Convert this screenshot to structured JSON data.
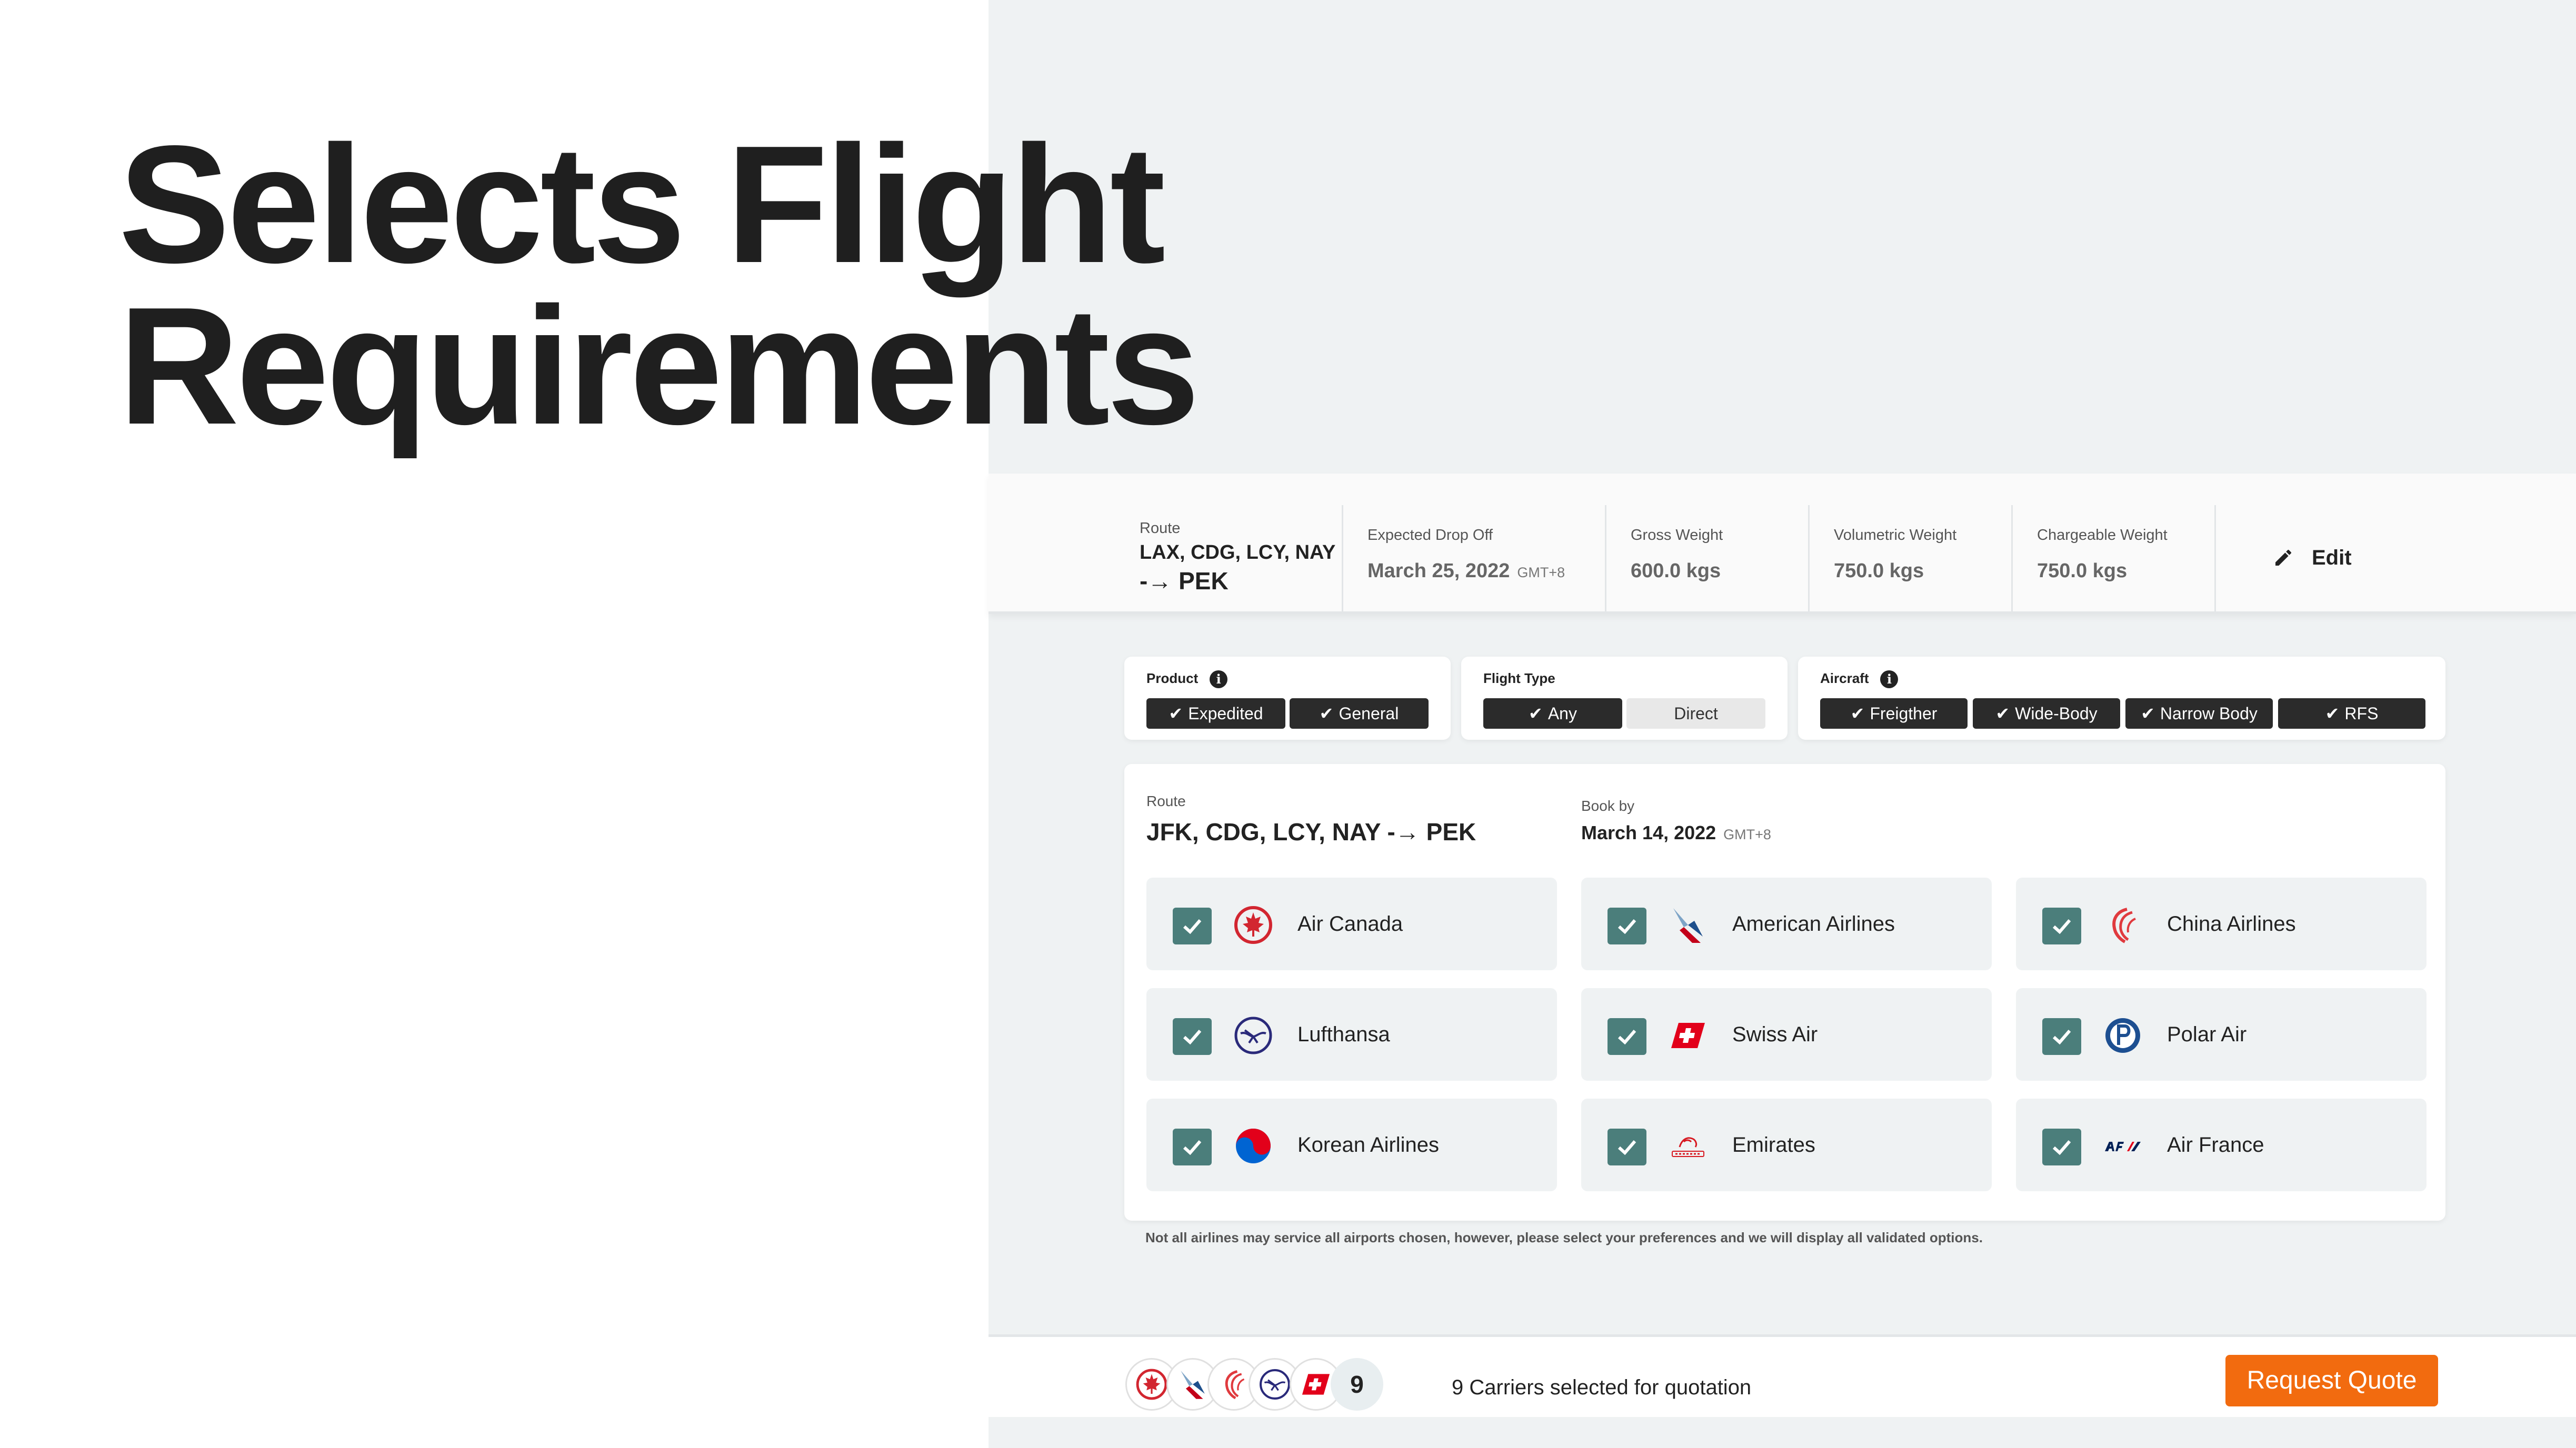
{
  "hero": {
    "line1": "Selects Flight",
    "line2": "Requirements"
  },
  "summary": {
    "route": {
      "label": "Route",
      "value_line1": "LAX, CDG, LCY, NAY",
      "value_line2": "-→ PEK"
    },
    "drop_off": {
      "label": "Expected Drop Off",
      "value": "March 25, 2022",
      "tz": "GMT+8"
    },
    "gross": {
      "label": "Gross Weight",
      "value": "600.0 kgs"
    },
    "volumetric": {
      "label": "Volumetric Weight",
      "value": "750.0 kgs"
    },
    "chargeable": {
      "label": "Chargeable Weight",
      "value": "750.0 kgs"
    },
    "edit_label": "Edit"
  },
  "filters": {
    "product": {
      "label": "Product",
      "options": [
        {
          "label": "Expedited",
          "selected": true
        },
        {
          "label": "General",
          "selected": true
        }
      ]
    },
    "flight_type": {
      "label": "Flight Type",
      "options": [
        {
          "label": "Any",
          "selected": true
        },
        {
          "label": "Direct",
          "selected": false
        }
      ]
    },
    "aircraft": {
      "label": "Aircraft",
      "options": [
        {
          "label": "Freigther",
          "selected": true
        },
        {
          "label": "Wide-Body",
          "selected": true
        },
        {
          "label": "Narrow Body",
          "selected": true
        },
        {
          "label": "RFS",
          "selected": true
        }
      ]
    }
  },
  "route_card": {
    "route_label": "Route",
    "route_value": "JFK, CDG, LCY, NAY -→ PEK",
    "book_label": "Book by",
    "book_value": "March 14, 2022",
    "book_tz": "GMT+8"
  },
  "airlines": [
    {
      "name": "Air Canada",
      "checked": true,
      "icon": "air-canada-logo-icon",
      "color": "#d22630"
    },
    {
      "name": "American Airlines",
      "checked": true,
      "icon": "american-airlines-logo-icon",
      "color": "#c30019"
    },
    {
      "name": "China Airlines",
      "checked": true,
      "icon": "china-airlines-logo-icon",
      "color": "#e03a3e"
    },
    {
      "name": "Lufthansa",
      "checked": true,
      "icon": "lufthansa-logo-icon",
      "color": "#2a2a7a"
    },
    {
      "name": "Swiss Air",
      "checked": true,
      "icon": "swiss-air-logo-icon",
      "color": "#e2001a"
    },
    {
      "name": "Polar Air",
      "checked": true,
      "icon": "polar-air-logo-icon",
      "color": "#1d4f91"
    },
    {
      "name": "Korean Airlines",
      "checked": true,
      "icon": "korean-airlines-logo-icon",
      "color": "#0064d2"
    },
    {
      "name": "Emirates",
      "checked": true,
      "icon": "emirates-logo-icon",
      "color": "#d71921"
    },
    {
      "name": "Air France",
      "checked": true,
      "icon": "air-france-logo-icon",
      "color": "#002157"
    }
  ],
  "disclaimer": "Not all airlines may service all airports chosen, however, please select your preferences and we will display all validated options.",
  "footer": {
    "count": "9",
    "carriers_text": "9 Carriers selected for quotation",
    "request_label": "Request Quote"
  },
  "colors": {
    "accent": "#f26b0f",
    "checkbox": "#4b7e7b",
    "chip_dark": "#2b2b2b",
    "panel_bg": "#eff2f3"
  }
}
